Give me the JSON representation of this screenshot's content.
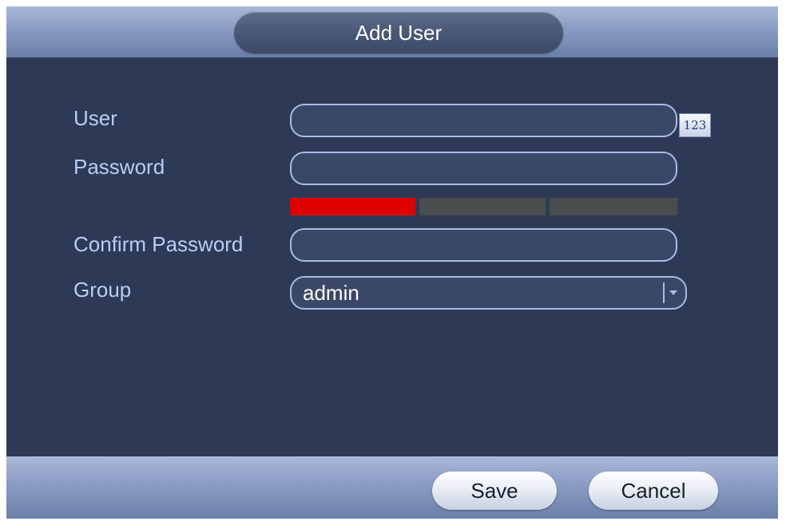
{
  "dialog": {
    "title": "Add User"
  },
  "form": {
    "user": {
      "label": "User",
      "value": "",
      "keyboard_button_label": "123"
    },
    "password": {
      "label": "Password",
      "value": ""
    },
    "password_strength": {
      "level": 1,
      "max_level": 3,
      "colors": {
        "active": "#e00000",
        "inactive": "#4a4d4d"
      }
    },
    "confirm_password": {
      "label": "Confirm Password",
      "value": ""
    },
    "group": {
      "label": "Group",
      "selected": "admin"
    }
  },
  "footer": {
    "save_label": "Save",
    "cancel_label": "Cancel"
  },
  "icons": {
    "dropdown": "chevron-down-icon"
  }
}
